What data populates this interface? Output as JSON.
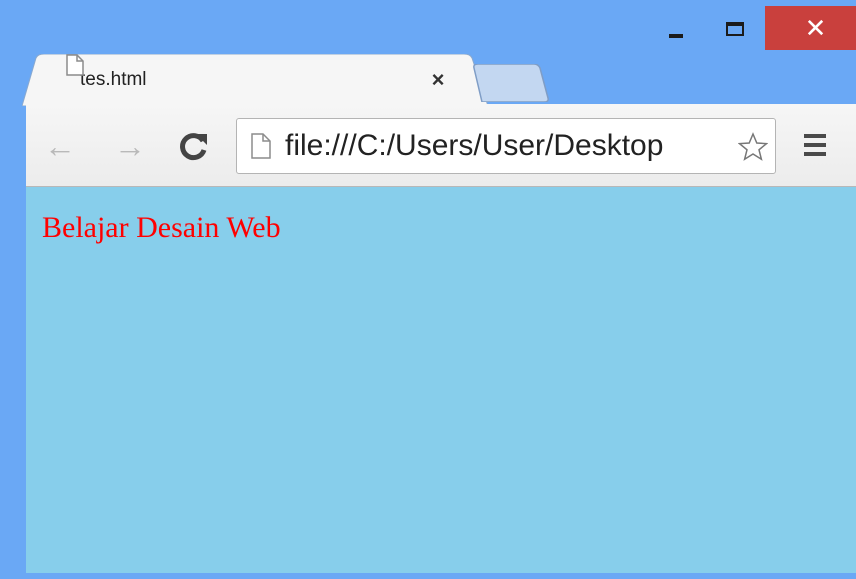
{
  "window": {
    "minimize_icon": "minimize-icon",
    "maximize_icon": "maximize-icon",
    "close_icon": "close-icon",
    "close_glyph": "✕",
    "frame_color": "#6aa8f5",
    "close_color": "#c9403d"
  },
  "tabs": [
    {
      "title": "tes.html",
      "close_glyph": "×",
      "icon": "page-icon",
      "active": true
    }
  ],
  "toolbar": {
    "back_glyph": "←",
    "forward_glyph": "→",
    "reload_glyph": "C",
    "url": "file:///C:/Users/User/Desktop",
    "menu_icon": "hamburger-menu-icon",
    "star_icon": "star-icon"
  },
  "page": {
    "text": "Belajar Desain Web",
    "text_color": "#ff0000",
    "background": "#87ceeb"
  }
}
